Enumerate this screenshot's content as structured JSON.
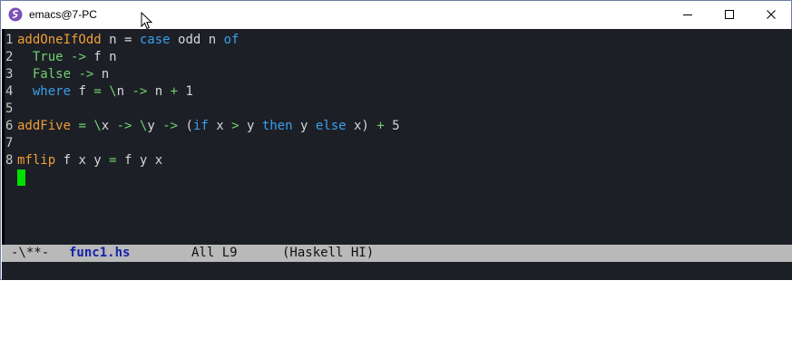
{
  "window": {
    "title": "emacs@7-PC",
    "icon": "emacs-icon",
    "controls": [
      "minimize-icon",
      "maximize-icon",
      "close-icon"
    ]
  },
  "editor": {
    "lines": [
      {
        "num": "1",
        "tokens": [
          {
            "t": "addOneIfOdd",
            "c": "fn"
          },
          {
            "t": " n = ",
            "c": "txt"
          },
          {
            "t": "case",
            "c": "kw"
          },
          {
            "t": " odd n ",
            "c": "txt"
          },
          {
            "t": "of",
            "c": "kw"
          }
        ]
      },
      {
        "num": "2",
        "tokens": [
          {
            "t": "  ",
            "c": "txt"
          },
          {
            "t": "True",
            "c": "con"
          },
          {
            "t": " ",
            "c": "txt"
          },
          {
            "t": "->",
            "c": "op"
          },
          {
            "t": " f n",
            "c": "txt"
          }
        ]
      },
      {
        "num": "3",
        "tokens": [
          {
            "t": "  ",
            "c": "txt"
          },
          {
            "t": "False",
            "c": "con"
          },
          {
            "t": " ",
            "c": "txt"
          },
          {
            "t": "->",
            "c": "op"
          },
          {
            "t": " n",
            "c": "txt"
          }
        ]
      },
      {
        "num": "4",
        "tokens": [
          {
            "t": "  ",
            "c": "txt"
          },
          {
            "t": "where",
            "c": "kw"
          },
          {
            "t": " f ",
            "c": "txt"
          },
          {
            "t": "=",
            "c": "op"
          },
          {
            "t": " ",
            "c": "txt"
          },
          {
            "t": "\\",
            "c": "op"
          },
          {
            "t": "n ",
            "c": "txt"
          },
          {
            "t": "->",
            "c": "op"
          },
          {
            "t": " n ",
            "c": "txt"
          },
          {
            "t": "+",
            "c": "op"
          },
          {
            "t": " 1",
            "c": "txt"
          }
        ]
      },
      {
        "num": "5",
        "tokens": []
      },
      {
        "num": "6",
        "tokens": [
          {
            "t": "addFive",
            "c": "fn"
          },
          {
            "t": " ",
            "c": "txt"
          },
          {
            "t": "=",
            "c": "op"
          },
          {
            "t": " ",
            "c": "txt"
          },
          {
            "t": "\\",
            "c": "op"
          },
          {
            "t": "x ",
            "c": "txt"
          },
          {
            "t": "->",
            "c": "op"
          },
          {
            "t": " ",
            "c": "txt"
          },
          {
            "t": "\\",
            "c": "op"
          },
          {
            "t": "y ",
            "c": "txt"
          },
          {
            "t": "->",
            "c": "op"
          },
          {
            "t": " (",
            "c": "txt"
          },
          {
            "t": "if",
            "c": "kw"
          },
          {
            "t": " x ",
            "c": "txt"
          },
          {
            "t": ">",
            "c": "op"
          },
          {
            "t": " y ",
            "c": "txt"
          },
          {
            "t": "then",
            "c": "kw"
          },
          {
            "t": " y ",
            "c": "txt"
          },
          {
            "t": "else",
            "c": "kw"
          },
          {
            "t": " x) ",
            "c": "txt"
          },
          {
            "t": "+",
            "c": "op"
          },
          {
            "t": " 5",
            "c": "txt"
          }
        ]
      },
      {
        "num": "7",
        "tokens": []
      },
      {
        "num": "8",
        "tokens": [
          {
            "t": "mflip",
            "c": "fn"
          },
          {
            "t": " f x y ",
            "c": "txt"
          },
          {
            "t": "=",
            "c": "op"
          },
          {
            "t": " f y x",
            "c": "txt"
          }
        ]
      }
    ],
    "colors": {
      "background": "#1d1f27",
      "function": "#ee9e35",
      "keyword": "#3aa0e8",
      "constructor": "#6ed36e",
      "cursor": "#00e000"
    }
  },
  "modeline": {
    "state": "-\\**-",
    "buffer": "func1.hs",
    "position": "All L9",
    "mode": "(Haskell HI)"
  }
}
